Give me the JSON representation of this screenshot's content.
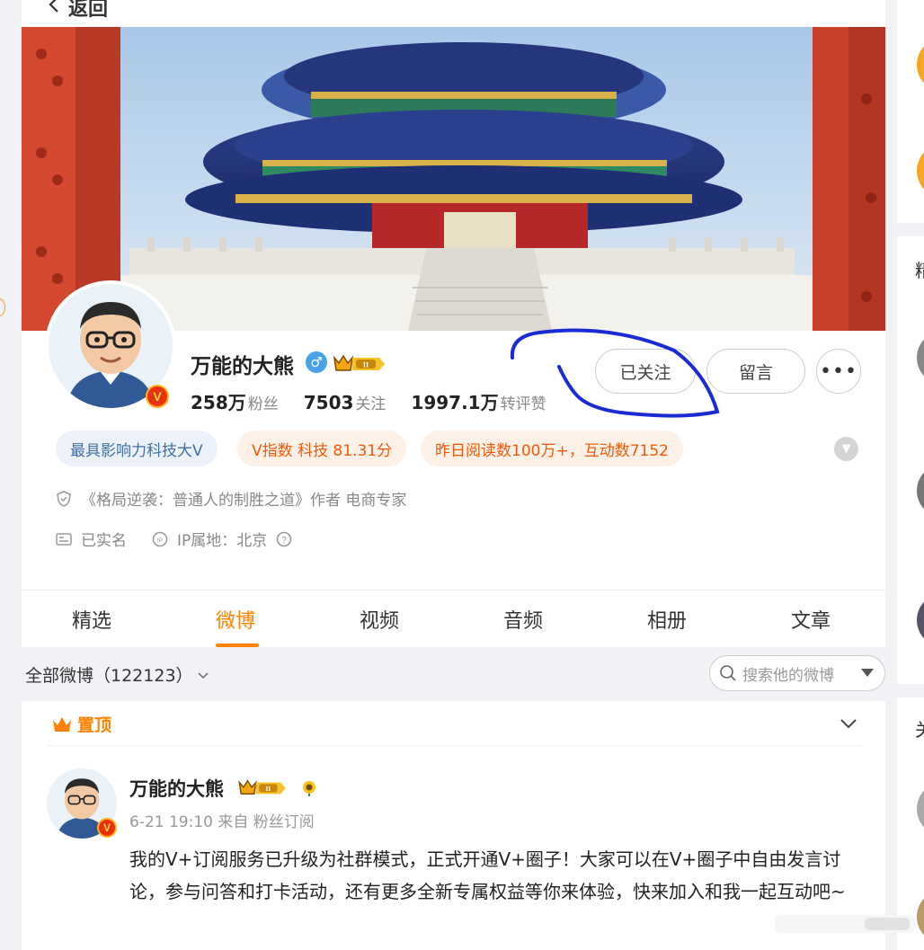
{
  "header": {
    "back_label": "返回"
  },
  "profile": {
    "name": "万能的大熊",
    "verified_badge": "V",
    "fans_count": "258万",
    "fans_label": "粉丝",
    "following_count": "7503",
    "following_label": "关注",
    "reposts_count": "1997.1万",
    "reposts_label": "转评赞",
    "follow_button": "已关注",
    "message_button": "留言",
    "more_button": "•••",
    "gender_symbol": "♂"
  },
  "tags": [
    {
      "label": "最具影响力科技大V"
    },
    {
      "label": "V指数 科技 81.31分"
    },
    {
      "label": "昨日阅读数100万+，互动数7152"
    }
  ],
  "info": {
    "bio": "《格局逆袭：普通人的制胜之道》作者 电商专家",
    "real_name": "已实名",
    "ip_location": "IP属地：北京"
  },
  "tabs": [
    {
      "label": "精选"
    },
    {
      "label": "微博"
    },
    {
      "label": "视频"
    },
    {
      "label": "音频"
    },
    {
      "label": "相册"
    },
    {
      "label": "文章"
    }
  ],
  "feed": {
    "all_label": "全部微博（122123）",
    "search_placeholder": "搜索他的微博"
  },
  "post": {
    "pin_label": "置顶",
    "author": "万能的大熊",
    "meta": "6-21 19:10 来自 粉丝订阅",
    "text": "我的V+订阅服务已升级为社群模式，正式开通V+圈子！大家可以在V+圈子中自由发言讨论，参与问答和打卡活动，还有更多全新专属权益等你来体验，快来加入和我一起互动吧~"
  },
  "sidebar": {
    "partial_1": "精",
    "partial_2": "关"
  },
  "colors": {
    "accent": "#ff8200",
    "annotation": "#1a2bd6",
    "tag_blue": "#3f6fa8",
    "tag_orange": "#f05a0a"
  },
  "icons": [
    "back-arrow-icon",
    "male-icon",
    "crown-icon",
    "more-icon",
    "chevron-down-icon",
    "shield-icon",
    "id-card-icon",
    "ip-icon",
    "question-icon",
    "search-icon",
    "dropdown-icon",
    "sunflower-icon"
  ]
}
